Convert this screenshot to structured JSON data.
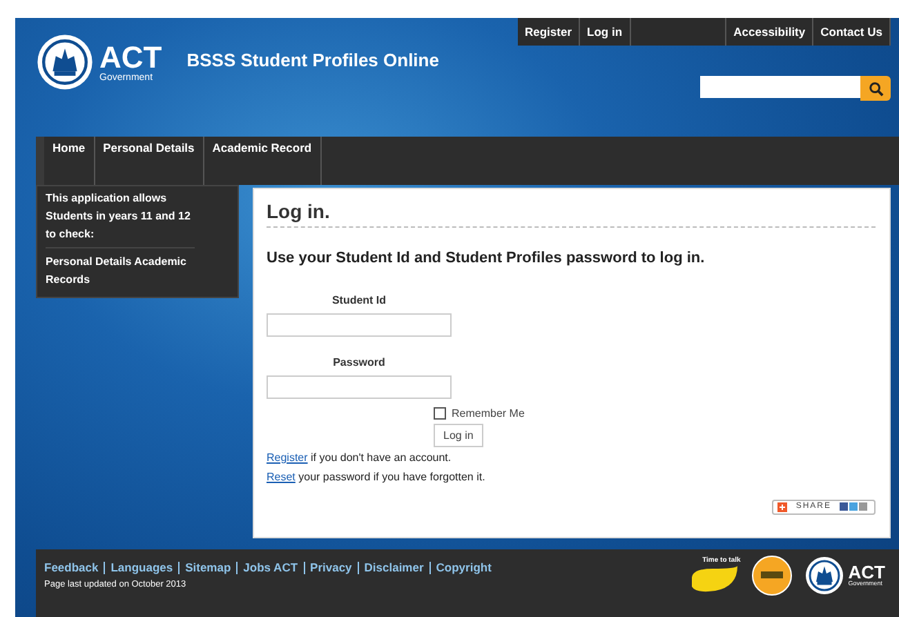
{
  "header": {
    "logo_text": "ACT",
    "logo_subtext": "Government",
    "site_title": "BSSS Student Profiles Online",
    "account_links": [
      "Register",
      "Log in"
    ],
    "utility_links": [
      "Accessibility",
      "Contact Us"
    ]
  },
  "nav": {
    "items": [
      "Home",
      "Personal Details",
      "Academic Record"
    ]
  },
  "sidebar": {
    "intro": "This application allows Students in years 11 and 12 to check:",
    "items": [
      "Personal Details Academic Records"
    ]
  },
  "login": {
    "title": "Log in.",
    "subtitle": "Use your Student Id and Student Profiles password to log in.",
    "fields": [
      {
        "label": "Student Id"
      },
      {
        "label": "Password"
      }
    ],
    "remember": {
      "label": "Remember Me",
      "checked": false
    },
    "submit": "Log in",
    "help": [
      {
        "link": "Register",
        "text": " if you don't have an account."
      },
      {
        "link": "Reset",
        "text": " your password if you have forgotten it."
      }
    ],
    "share": "SHARE"
  },
  "footer": {
    "links": [
      "Feedback",
      "Languages",
      "Sitemap",
      "Jobs ACT",
      "Privacy",
      "Disclaimer",
      "Copyright"
    ],
    "updated": "Page last updated on October 2013",
    "badge_caption": "Time to talk",
    "logo_text": "ACT",
    "logo_subtext": "Government"
  }
}
